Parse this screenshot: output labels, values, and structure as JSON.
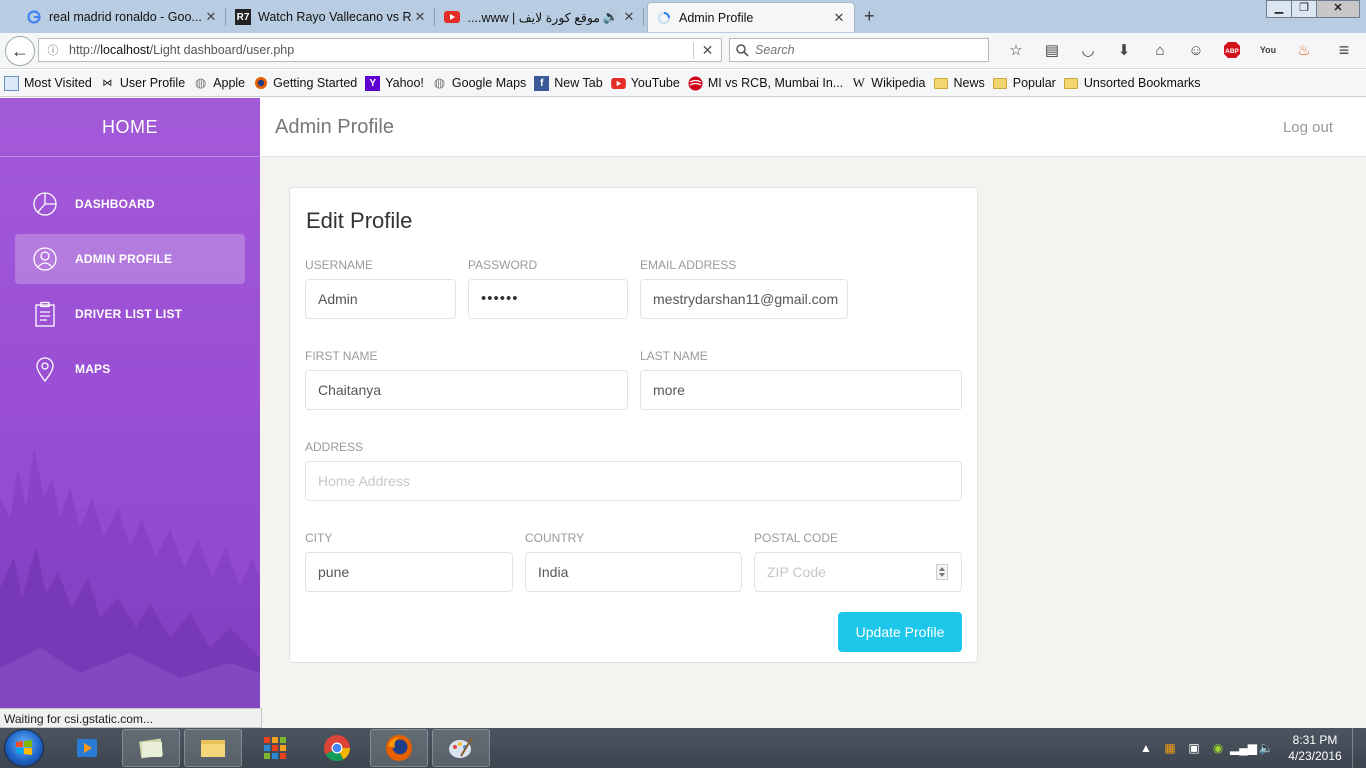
{
  "browser": {
    "tabs": [
      {
        "title": "real madrid ronaldo - Goo...",
        "icon": "google-icon"
      },
      {
        "title": "Watch Rayo Vallecano vs R...",
        "icon": "r7-icon"
      },
      {
        "title": "موقع كورة لايف | www....",
        "icon": "youtube-icon",
        "audio": true
      },
      {
        "title": "Admin Profile",
        "icon": "loading-icon"
      }
    ],
    "url_prefix": "http://",
    "url_host": "localhost",
    "url_path": "/Light dashboard/user.php",
    "search_placeholder": "Search",
    "bookmarks": [
      {
        "label": "Most Visited"
      },
      {
        "label": "User Profile"
      },
      {
        "label": "Apple"
      },
      {
        "label": "Getting Started"
      },
      {
        "label": "Yahoo!"
      },
      {
        "label": "Google Maps"
      },
      {
        "label": "New Tab"
      },
      {
        "label": "YouTube"
      },
      {
        "label": "MI vs RCB, Mumbai In..."
      },
      {
        "label": "Wikipedia"
      },
      {
        "label": "News"
      },
      {
        "label": "Popular"
      },
      {
        "label": "Unsorted Bookmarks"
      }
    ],
    "status": "Waiting for csi.gstatic.com..."
  },
  "sidebar": {
    "logo": "HOME",
    "items": [
      {
        "label": "DASHBOARD",
        "icon": "pie-chart-icon"
      },
      {
        "label": "ADMIN PROFILE",
        "icon": "user-icon"
      },
      {
        "label": "DRIVER LIST LIST",
        "icon": "clipboard-icon"
      },
      {
        "label": "MAPS",
        "icon": "map-pin-icon"
      }
    ]
  },
  "topnav": {
    "title": "Admin Profile",
    "logout": "Log out"
  },
  "form": {
    "title": "Edit Profile",
    "username": {
      "label": "USERNAME",
      "value": "Admin"
    },
    "password": {
      "label": "PASSWORD",
      "value": "••••••"
    },
    "email": {
      "label": "EMAIL ADDRESS",
      "value": "mestrydarshan11@gmail.com"
    },
    "first_name": {
      "label": "FIRST NAME",
      "value": "Chaitanya"
    },
    "last_name": {
      "label": "LAST NAME",
      "value": "more"
    },
    "address": {
      "label": "ADDRESS",
      "placeholder": "Home Address"
    },
    "city": {
      "label": "CITY",
      "value": "pune"
    },
    "country": {
      "label": "COUNTRY",
      "value": "India"
    },
    "postal": {
      "label": "POSTAL CODE",
      "placeholder": "ZIP Code"
    },
    "submit": "Update Profile"
  },
  "taskbar": {
    "time": "8:31 PM",
    "date": "4/23/2016"
  },
  "colors": {
    "sidebar": "#9a4fd4",
    "accent": "#1dc7ea"
  }
}
